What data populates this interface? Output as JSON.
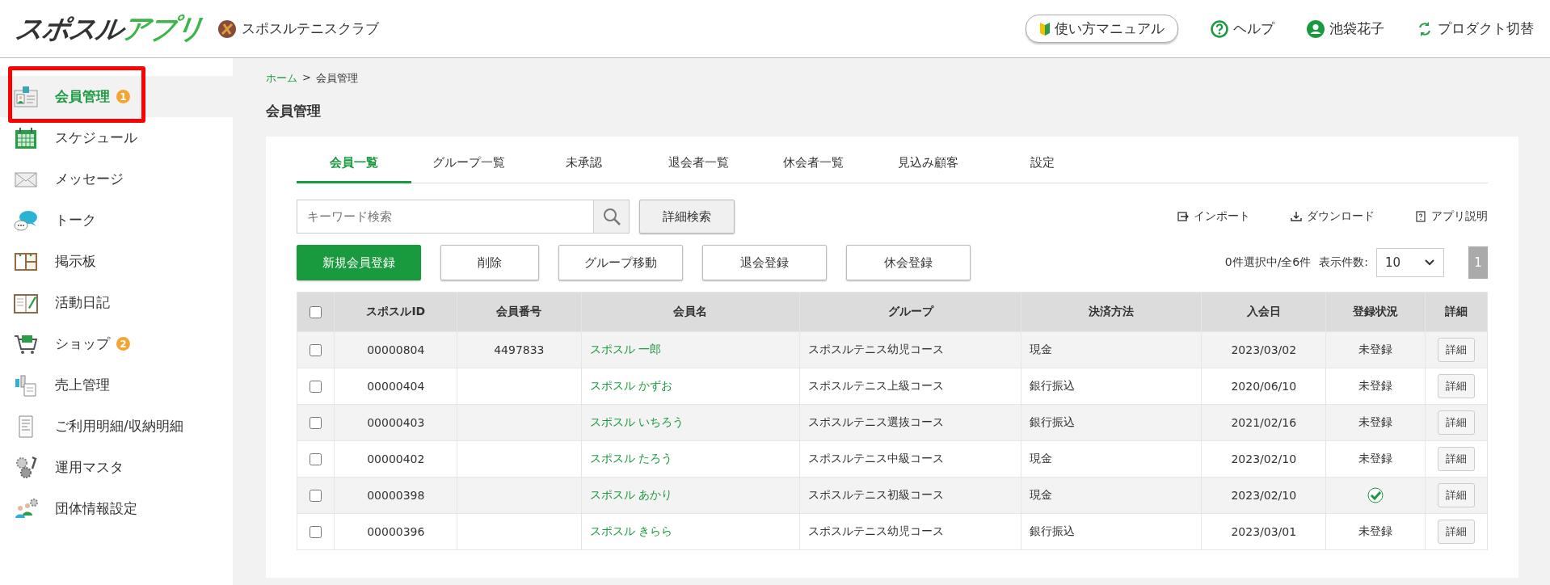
{
  "header": {
    "logo": {
      "main": "スポスル",
      "accent": "アプリ"
    },
    "club": "スポスルテニスクラブ",
    "manual": "使い方マニュアル",
    "help": "ヘルプ",
    "user": "池袋花子",
    "switch": "プロダクト切替"
  },
  "sidebar": {
    "items": [
      {
        "label": "会員管理",
        "selected": true,
        "annotated": true,
        "badge": "1"
      },
      {
        "label": "スケジュール",
        "selected": false,
        "annotated": false
      },
      {
        "label": "メッセージ",
        "selected": false,
        "annotated": false
      },
      {
        "label": "トーク",
        "selected": false,
        "annotated": false
      },
      {
        "label": "掲示板",
        "selected": false,
        "annotated": false
      },
      {
        "label": "活動日記",
        "selected": false,
        "annotated": false
      },
      {
        "label": "ショップ",
        "selected": false,
        "annotated": false,
        "badge": "2"
      },
      {
        "label": "売上管理",
        "selected": false,
        "annotated": false
      },
      {
        "label": "ご利用明細/収納明細",
        "selected": false,
        "annotated": false
      },
      {
        "label": "運用マスタ",
        "selected": false,
        "annotated": false
      },
      {
        "label": "団体情報設定",
        "selected": false,
        "annotated": false
      }
    ]
  },
  "breadcrumb": {
    "home": "ホーム",
    "separator": ">",
    "current": "会員管理"
  },
  "page_title": "会員管理",
  "tabs": [
    {
      "label": "会員一覧",
      "selected": true
    },
    {
      "label": "グループ一覧",
      "selected": false
    },
    {
      "label": "未承認",
      "selected": false
    },
    {
      "label": "退会者一覧",
      "selected": false
    },
    {
      "label": "休会者一覧",
      "selected": false
    },
    {
      "label": "見込み顧客",
      "selected": false
    },
    {
      "label": "設定",
      "selected": false
    }
  ],
  "search": {
    "placeholder": "キーワード検索",
    "advanced": "詳細検索"
  },
  "links": {
    "import": "インポート",
    "download": "ダウンロード",
    "app_help": "アプリ説明"
  },
  "actions": [
    {
      "label": "新規会員登録",
      "kind": "primary"
    },
    {
      "label": "削除",
      "kind": "plain"
    },
    {
      "label": "グループ移動",
      "kind": "plain"
    },
    {
      "label": "退会登録",
      "kind": "plain"
    },
    {
      "label": "休会登録",
      "kind": "plain"
    }
  ],
  "summary": "0件選択中/全6件",
  "page_size": {
    "label": "表示件数:",
    "value": "10"
  },
  "pages": [
    "1"
  ],
  "table": {
    "select_all": false,
    "columns": [
      "スポスルID",
      "会員番号",
      "会員名",
      "グループ",
      "決済方法",
      "入会日",
      "登録状況",
      "詳細"
    ],
    "rows": [
      {
        "selected": false,
        "id": "00000804",
        "number": "4497833",
        "name": "スポスル 一郎",
        "group": "スポスルテニス幼児コース",
        "payment": "現金",
        "joined": "2023/03/02",
        "status": {
          "kind": "text",
          "text": "未登録"
        },
        "detail": "詳細"
      },
      {
        "selected": false,
        "id": "00000404",
        "name": "スポスル かずお",
        "group": "スポスルテニス上級コース",
        "payment": "銀行振込",
        "joined": "2020/06/10",
        "status": {
          "kind": "text",
          "text": "未登録"
        },
        "detail": "詳細"
      },
      {
        "selected": false,
        "id": "00000403",
        "name": "スポスル いちろう",
        "group": "スポスルテニス選抜コース",
        "payment": "銀行振込",
        "joined": "2021/02/16",
        "status": {
          "kind": "text",
          "text": "未登録"
        },
        "detail": "詳細"
      },
      {
        "selected": false,
        "id": "00000402",
        "name": "スポスル たろう",
        "group": "スポスルテニス中級コース",
        "payment": "現金",
        "joined": "2023/02/10",
        "status": {
          "kind": "text",
          "text": "未登録"
        },
        "detail": "詳細"
      },
      {
        "selected": false,
        "id": "00000398",
        "name": "スポスル あかり",
        "group": "スポスルテニス初級コース",
        "payment": "現金",
        "joined": "2023/02/10",
        "status": {
          "kind": "check"
        },
        "detail": "詳細"
      },
      {
        "selected": false,
        "id": "00000396",
        "name": "スポスル きらら",
        "group": "スポスルテニス幼児コース",
        "payment": "銀行振込",
        "joined": "2023/03/01",
        "status": {
          "kind": "text",
          "text": "未登録"
        },
        "detail": "詳細"
      }
    ]
  }
}
